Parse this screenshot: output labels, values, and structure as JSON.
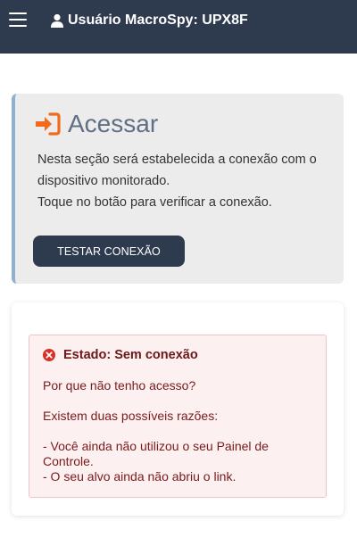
{
  "header": {
    "title": "Usuário MacroSpy: UPX8F",
    "menu_icon": "hamburger-icon",
    "user_icon": "user-icon"
  },
  "access": {
    "icon": "sign-in-icon",
    "title": "Acessar",
    "description_line1": "Nesta seção será estabelecida a conexão com o dispositivo monitorado.",
    "description_line2": "Toque no botão para verificar a conexão.",
    "button_label": "TESTAR CONEXÃO"
  },
  "status": {
    "icon": "error-circle-icon",
    "heading": "Estado: Sem conexão",
    "question": "Por que não tenho acesso?",
    "reasons_intro": "Existem duas possíveis razões:",
    "reason1": "- Você ainda não utilizou o seu Painel de Controle.",
    "reason2": "- O seu alvo ainda não abriu o link."
  },
  "colors": {
    "header_bg": "#2e3a4e",
    "accent_orange": "#f26a1b",
    "alert_bg": "#fdf0f0",
    "alert_text": "#7a1a1a",
    "error_red": "#d93025"
  }
}
